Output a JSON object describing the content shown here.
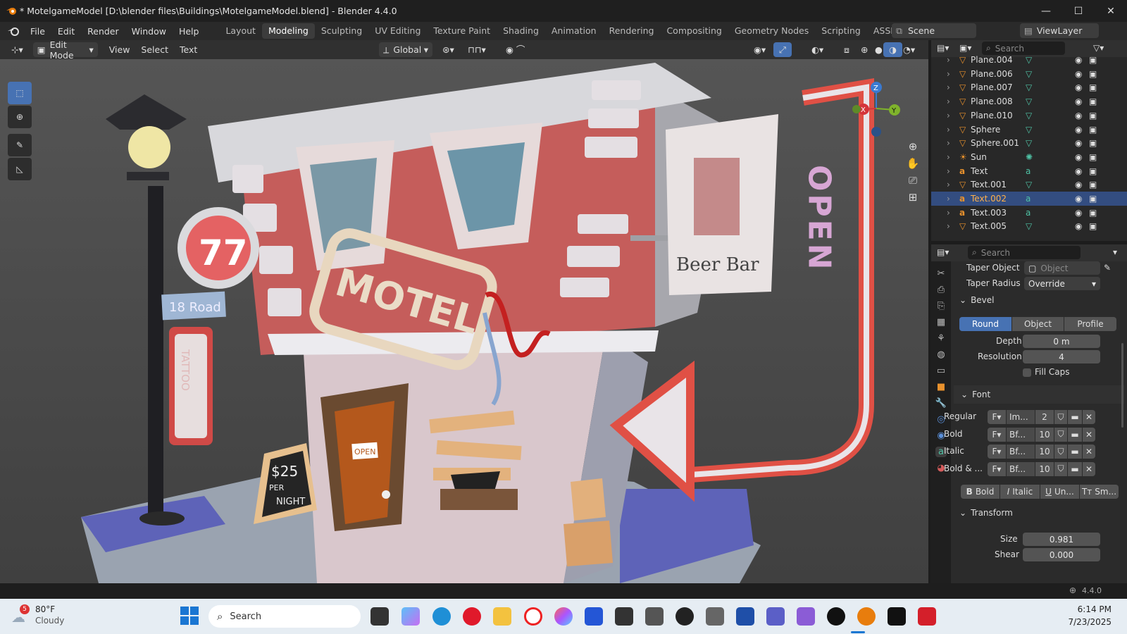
{
  "window": {
    "title": "* MotelgameModel [D:\\blender files\\Buildings\\MotelgameModel.blend] - Blender 4.4.0",
    "controls": [
      "—",
      "☐",
      "✕"
    ]
  },
  "menu": [
    "File",
    "Edit",
    "Render",
    "Window",
    "Help"
  ],
  "workspaces": [
    "Layout",
    "Modeling",
    "Sculpting",
    "UV Editing",
    "Texture Paint",
    "Shading",
    "Animation",
    "Rendering",
    "Compositing",
    "Geometry Nodes",
    "Scripting",
    "ASSESTS"
  ],
  "active_workspace": "Modeling",
  "scene": "Scene",
  "view_layer": "ViewLayer",
  "header": {
    "mode": "Edit Mode",
    "menus": [
      "View",
      "Select",
      "Text"
    ],
    "orientation": "Global"
  },
  "viewport": {
    "gizmo": {
      "x": "X",
      "y": "Y",
      "z": "Z"
    },
    "scene_text": {
      "motel": "MOTEL",
      "number": "77",
      "road": "18 Road",
      "tattoo": "TATTOO",
      "open_vertical": "OPEN",
      "beer": "Beer Bar",
      "door": "OPEN",
      "board1": "$25",
      "board2": "PER",
      "board3": "NIGHT"
    }
  },
  "outliner": {
    "search_placeholder": "Search",
    "items": [
      {
        "name": "Plane.004",
        "type": "mesh"
      },
      {
        "name": "Plane.006",
        "type": "mesh"
      },
      {
        "name": "Plane.007",
        "type": "mesh"
      },
      {
        "name": "Plane.008",
        "type": "mesh"
      },
      {
        "name": "Plane.010",
        "type": "mesh"
      },
      {
        "name": "Sphere",
        "type": "mesh"
      },
      {
        "name": "Sphere.001",
        "type": "mesh"
      },
      {
        "name": "Sun",
        "type": "light"
      },
      {
        "name": "Text",
        "type": "text"
      },
      {
        "name": "Text.001",
        "type": "mesh"
      },
      {
        "name": "Text.002",
        "type": "text",
        "selected": true
      },
      {
        "name": "Text.003",
        "type": "text"
      },
      {
        "name": "Text.005",
        "type": "mesh"
      }
    ]
  },
  "properties": {
    "search_placeholder": "Search",
    "taper_object_label": "Taper Object",
    "taper_object_placeholder": "Object",
    "taper_radius_label": "Taper Radius",
    "taper_radius_value": "Override",
    "bevel": {
      "title": "Bevel",
      "modes": [
        "Round",
        "Object",
        "Profile"
      ],
      "active_mode": "Round",
      "depth_label": "Depth",
      "depth_value": "0 m",
      "resolution_label": "Resolution",
      "resolution_value": "4",
      "fill_caps_label": "Fill Caps"
    },
    "font": {
      "title": "Font",
      "rows": [
        {
          "label": "Regular",
          "name": "Im...",
          "users": "2"
        },
        {
          "label": "Bold",
          "name": "Bf...",
          "users": "10"
        },
        {
          "label": "Italic",
          "name": "Bf...",
          "users": "10"
        },
        {
          "label": "Bold & ...",
          "name": "Bf...",
          "users": "10"
        }
      ],
      "styles": [
        "Bold",
        "Italic",
        "Un...",
        "Sm..."
      ]
    },
    "transform": {
      "title": "Transform",
      "size_label": "Size",
      "size_value": "0.981",
      "shear_label": "Shear",
      "shear_value": "0.000"
    }
  },
  "status": {
    "version": "4.4.0"
  },
  "taskbar": {
    "weather_temp": "80°F",
    "weather_desc": "Cloudy",
    "weather_badge": "5",
    "search_label": "Search",
    "time": "6:14 PM",
    "date": "7/23/2025"
  },
  "colors": {
    "accent": "#4772b3",
    "selected_row": "#334d80",
    "mesh_icon": "#e8912d",
    "data_icon": "#4fc2a5"
  }
}
